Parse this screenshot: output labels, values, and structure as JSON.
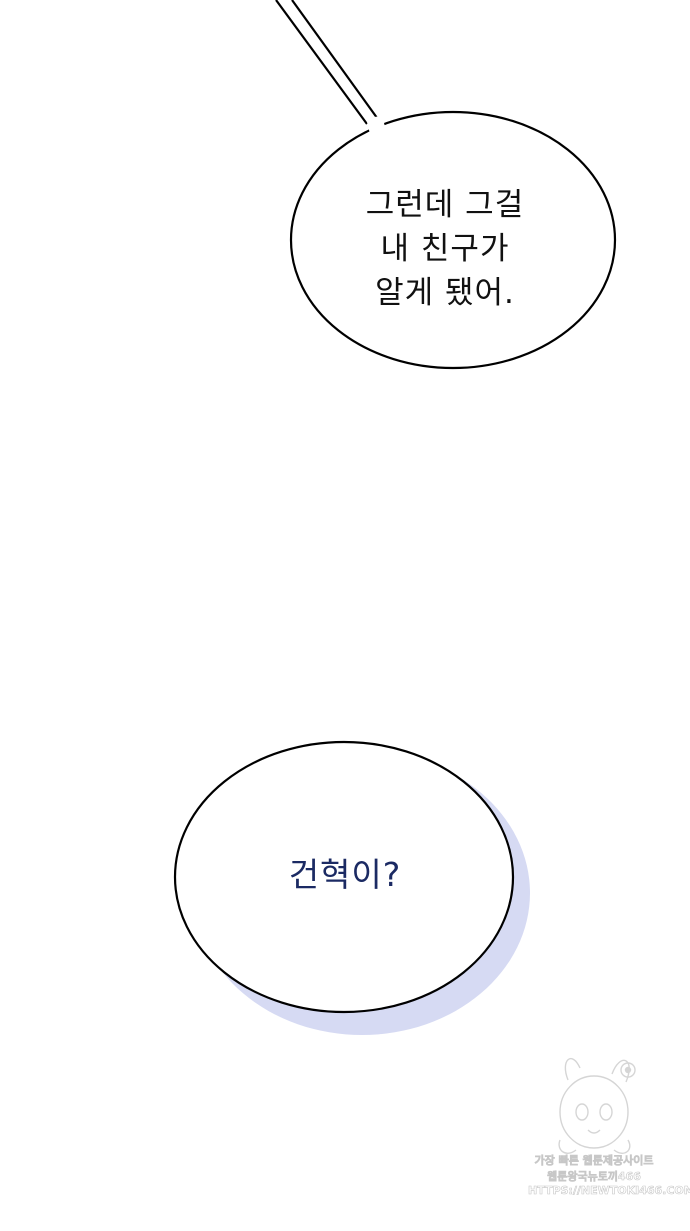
{
  "panel": {
    "background_color": "#ffffff"
  },
  "bubbles": [
    {
      "text": "그런데 그걸\n내 친구가\n알게 됐어.",
      "text_color": "#111111",
      "border_color": "#000000"
    },
    {
      "text": "건혁이?",
      "text_color": "#1b2a63",
      "border_color": "#000000",
      "shadow_color": "#d6daf3"
    }
  ],
  "watermark": {
    "lines": [
      "가장 빠른 웹툰제공사이트",
      "웹툰왕국뉴토끼466",
      "HTTPS://NEWTOKI466.COM"
    ],
    "icon": "rabbit-mascot-icon"
  }
}
